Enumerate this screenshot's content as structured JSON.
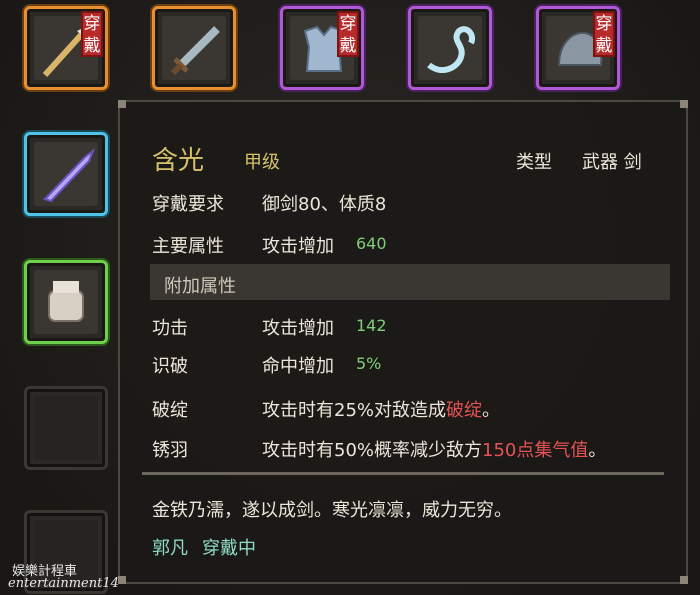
{
  "equipment_slots": [
    {
      "id": "slot-1",
      "rarity": "orange",
      "icon": "spear-icon",
      "equipped_badge": "穿戴"
    },
    {
      "id": "slot-2",
      "rarity": "orange",
      "icon": "sword-icon",
      "equipped_badge": ""
    },
    {
      "id": "slot-3",
      "rarity": "purple",
      "icon": "armor-icon",
      "equipped_badge": "穿戴"
    },
    {
      "id": "slot-4",
      "rarity": "purple",
      "icon": "ribbon-icon",
      "equipped_badge": ""
    },
    {
      "id": "slot-5",
      "rarity": "purple",
      "icon": "helmet-icon",
      "equipped_badge": "穿戴"
    },
    {
      "id": "slot-6",
      "rarity": "cyan",
      "icon": "dagger-icon",
      "equipped_badge": ""
    },
    {
      "id": "slot-7",
      "rarity": "green",
      "icon": "glove-icon",
      "equipped_badge": ""
    }
  ],
  "tooltip": {
    "item_name": "含光",
    "grade": "甲级",
    "type_label": "类型",
    "type_value": "武器 剑",
    "requirement_label": "穿戴要求",
    "requirement_value": "御剑80、体质8",
    "main_attr_label": "主要属性",
    "main_attr_text": "攻击增加",
    "main_attr_value": "640",
    "extra_section": "附加属性",
    "extra_attrs": [
      {
        "label": "功击",
        "text": "攻击增加",
        "value": "142"
      },
      {
        "label": "识破",
        "text": "命中增加",
        "value": "5%"
      }
    ],
    "skill1_label": "破绽",
    "skill1_pre": "攻击时有25%对敌造成",
    "skill1_hl": "破绽",
    "skill1_post": "。",
    "skill2_label": "锈羽",
    "skill2_pre": "攻击时有50%概率减少敌方",
    "skill2_num": "150点",
    "skill2_hl": "集气值",
    "skill2_post": "。",
    "description": "金铁乃濡，遂以成剑。寒光凛凛，威力无穷。",
    "wearer": "郭凡",
    "wearer_status": "穿戴中"
  },
  "watermark": {
    "line1": "娱樂計程車",
    "line2": "entertainment14"
  },
  "colors": {
    "orange": "#e8902c",
    "purple": "#b05ad6",
    "cyan": "#4fc3e6",
    "green": "#6fce4a",
    "badge": "#b82a2a",
    "highlight_red": "#e45353",
    "value_green": "#7fcf7a"
  }
}
